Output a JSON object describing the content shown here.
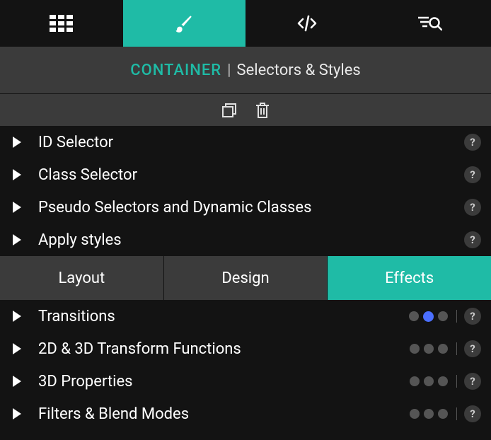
{
  "tabs_top": {
    "grid": "grid",
    "brush": "brush",
    "code": "code",
    "search": "search",
    "active": "brush"
  },
  "breadcrumb": {
    "element": "CONTAINER",
    "separator": "|",
    "panel": "Selectors & Styles"
  },
  "actions": {
    "copy": "copy-icon",
    "delete": "trash-icon"
  },
  "selector_sections": [
    {
      "label": "ID Selector"
    },
    {
      "label": "Class Selector"
    },
    {
      "label": "Pseudo Selectors and Dynamic Classes"
    },
    {
      "label": "Apply styles"
    }
  ],
  "subtabs": {
    "items": [
      "Layout",
      "Design",
      "Effects"
    ],
    "active": "Effects"
  },
  "effect_sections": [
    {
      "label": "Transitions",
      "dots": [
        "",
        "blue",
        ""
      ]
    },
    {
      "label": "2D & 3D Transform Functions",
      "dots": [
        "",
        "",
        ""
      ]
    },
    {
      "label": "3D Properties",
      "dots": [
        "",
        "",
        ""
      ]
    },
    {
      "label": "Filters & Blend Modes",
      "dots": [
        "",
        "",
        ""
      ]
    }
  ],
  "help_label": "?"
}
